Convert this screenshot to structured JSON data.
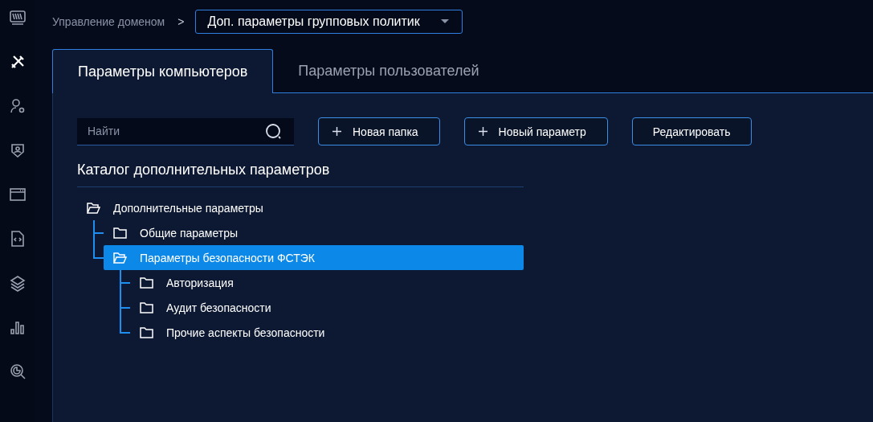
{
  "sidebar": {
    "items": [
      {
        "kind": "monitor",
        "selected": false
      },
      {
        "kind": "tools",
        "selected": true
      },
      {
        "kind": "user-gear",
        "selected": false
      },
      {
        "kind": "shield-user",
        "selected": false
      },
      {
        "kind": "window",
        "selected": false
      },
      {
        "kind": "code-file",
        "selected": false
      },
      {
        "kind": "layers",
        "selected": false
      },
      {
        "kind": "bars",
        "selected": false
      },
      {
        "kind": "search-chart",
        "selected": false
      }
    ]
  },
  "breadcrumb": {
    "parent": "Управление доменом",
    "separator": ">",
    "current": "Доп. параметры групповых политик"
  },
  "tabs": [
    {
      "label": "Параметры компьютеров",
      "selected": true
    },
    {
      "label": "Параметры пользователей",
      "selected": false
    }
  ],
  "search": {
    "placeholder": "Найти"
  },
  "buttons": [
    {
      "label": "Новая папка",
      "kind": "add"
    },
    {
      "label": "Новый параметр",
      "kind": "add"
    },
    {
      "label": "Редактировать",
      "kind": "plain"
    }
  ],
  "catalog": {
    "title": "Каталог дополнительных параметров",
    "tree": [
      {
        "label": "Дополнительные параметры",
        "expanded": true,
        "selected": false,
        "children": [
          {
            "label": "Общие параметры",
            "expanded": false,
            "selected": false
          },
          {
            "label": "Параметры безопасности ФСТЭК",
            "expanded": true,
            "selected": true,
            "children": [
              {
                "label": "Авторизация",
                "expanded": false,
                "selected": false
              },
              {
                "label": "Аудит безопасности",
                "expanded": false,
                "selected": false
              },
              {
                "label": "Прочие аспекты безопасности",
                "expanded": false,
                "selected": false
              }
            ]
          }
        ]
      }
    ]
  }
}
